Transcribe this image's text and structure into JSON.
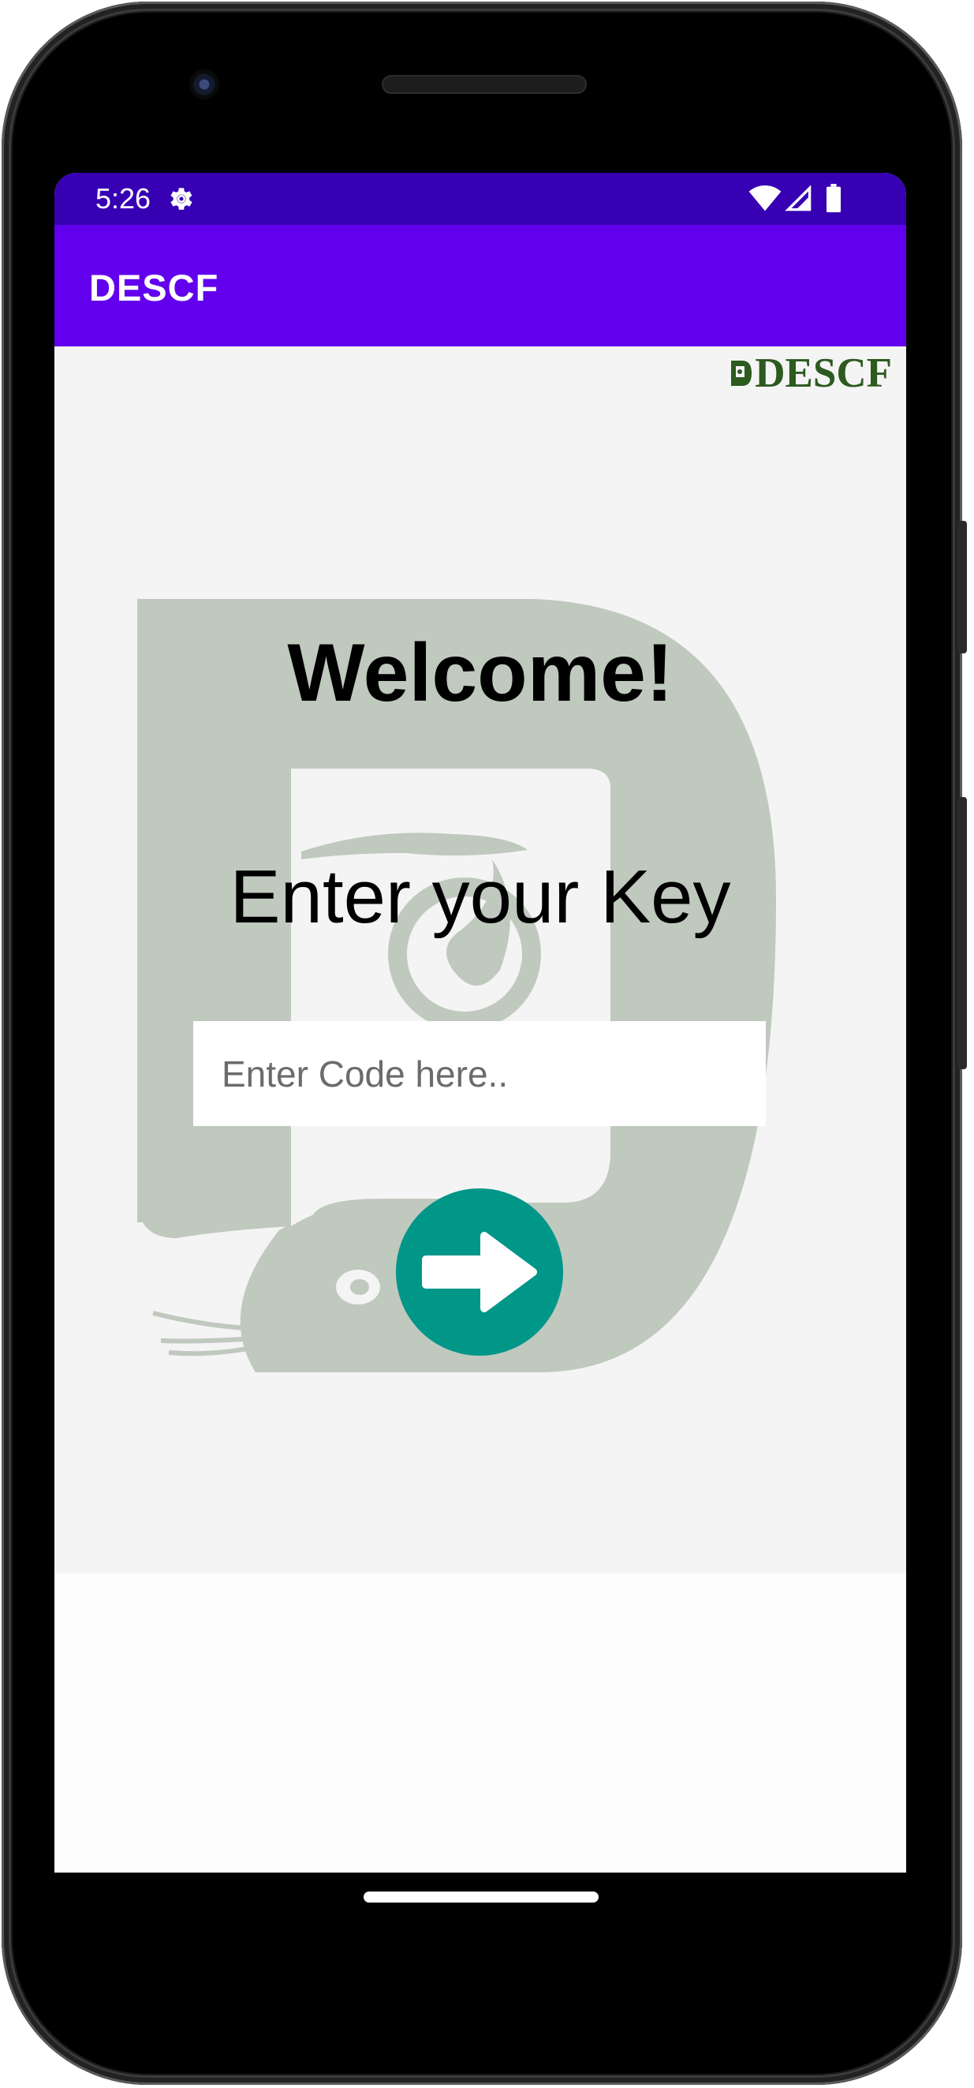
{
  "status_bar": {
    "time": "5:26",
    "icons": [
      "gear-icon",
      "wifi-icon",
      "signal-icon",
      "battery-icon"
    ]
  },
  "app_bar": {
    "title": "DESCF"
  },
  "brand_logo": {
    "text": "DESCF",
    "color": "#2d5a1f"
  },
  "main": {
    "welcome": "Welcome!",
    "prompt": "Enter your Key",
    "code_input": {
      "value": "",
      "placeholder": "Enter Code here.."
    },
    "submit_icon": "arrow-right-icon"
  },
  "colors": {
    "status_bar": "#3700b3",
    "app_bar": "#6200ee",
    "submit_button": "#009688",
    "emblem": "#bfc9bd",
    "content_bg": "#f4f4f4"
  }
}
